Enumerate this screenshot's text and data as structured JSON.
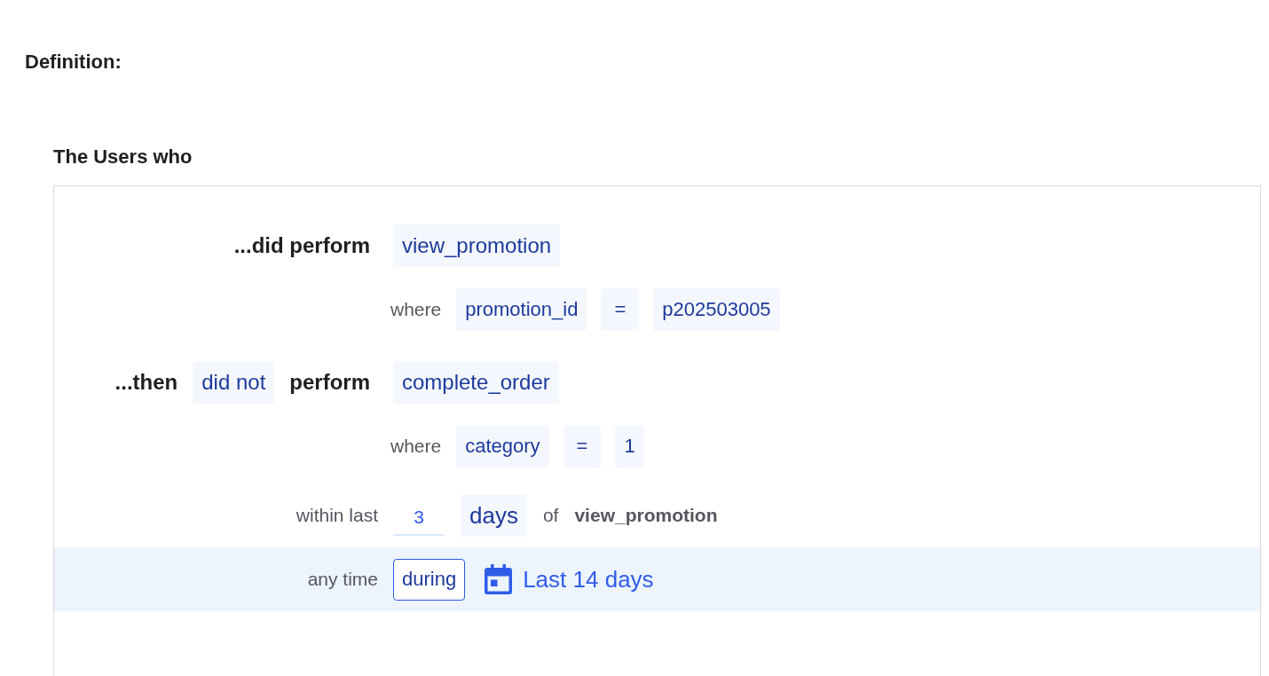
{
  "heading": "Definition:",
  "group": {
    "title": "The Users who",
    "steps": [
      {
        "prefix": "...did perform",
        "event": "view_promotion",
        "where": {
          "label": "where",
          "property": "promotion_id",
          "operator": "=",
          "value": "p202503005"
        }
      },
      {
        "prefix": "...then",
        "negation": "did not",
        "verb": "perform",
        "event": "complete_order",
        "where": {
          "label": "where",
          "property": "category",
          "operator": "=",
          "value": "1"
        }
      }
    ],
    "within": {
      "label": "within last",
      "amount": "3",
      "unit": "days",
      "connector": "of",
      "event": "view_promotion"
    },
    "time_range": {
      "label": "any time",
      "mode": "during",
      "range": "Last 14 days",
      "highlighted": true
    }
  }
}
